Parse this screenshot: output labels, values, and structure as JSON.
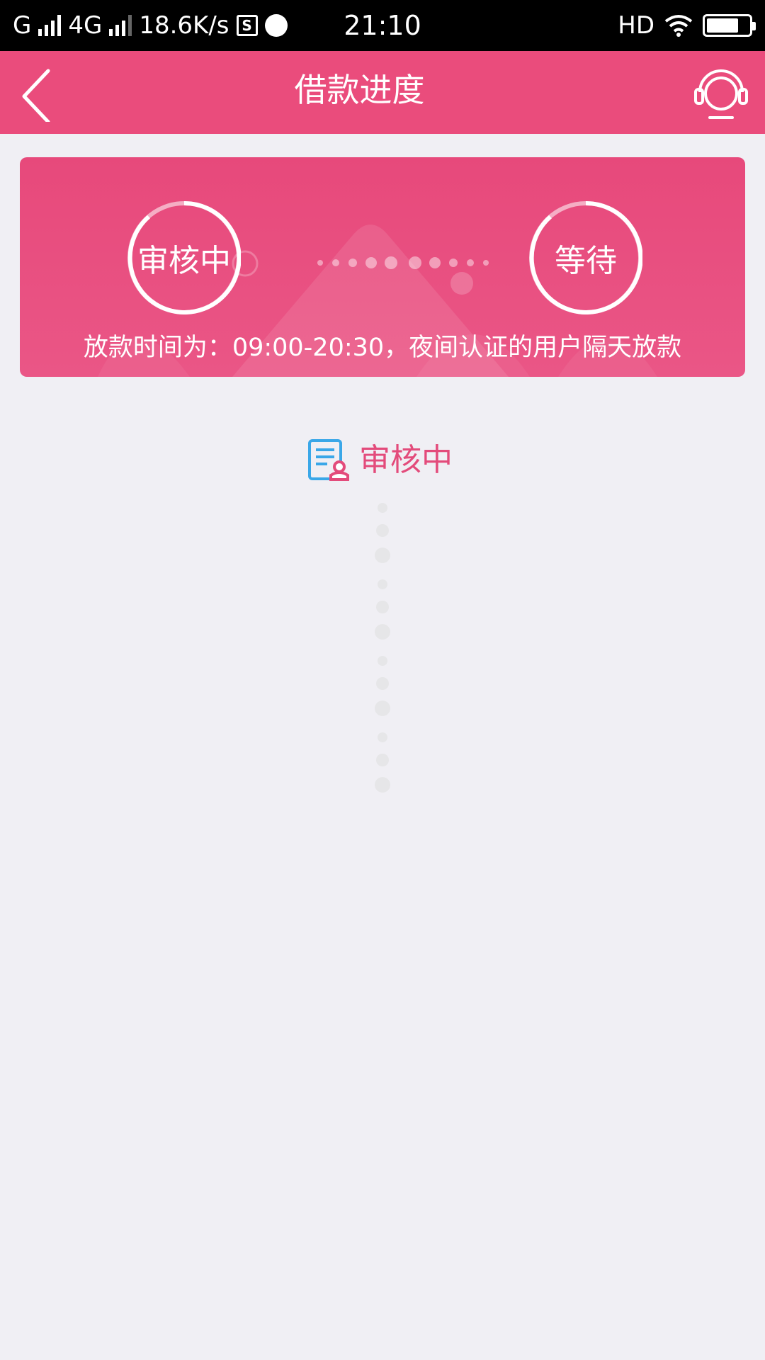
{
  "status_bar": {
    "carrier1": "G",
    "carrier2": "4G",
    "net_speed": "18.6K/s",
    "time": "21:10",
    "hd": "HD",
    "box_glyph": "S",
    "icons": [
      "signal-icon",
      "signal-icon",
      "sim-box-icon",
      "globe-icon",
      "wifi-icon",
      "battery-icon"
    ]
  },
  "header": {
    "title": "借款进度",
    "back_icon": "chevron-left-icon",
    "service_icon": "headset-icon"
  },
  "progress_card": {
    "steps": [
      {
        "label": "审核中"
      },
      {
        "label": "等待"
      }
    ],
    "release_note": "放款时间为：09:00-20:30，夜间认证的用户隔天放款"
  },
  "status": {
    "icon": "review-document-icon",
    "text": "审核中"
  },
  "colors": {
    "header": "#ea4c7c",
    "card": "#e7497b",
    "status_text": "#e34b7b",
    "icon_blue": "#3aa7e8",
    "background": "#f0eff4"
  }
}
